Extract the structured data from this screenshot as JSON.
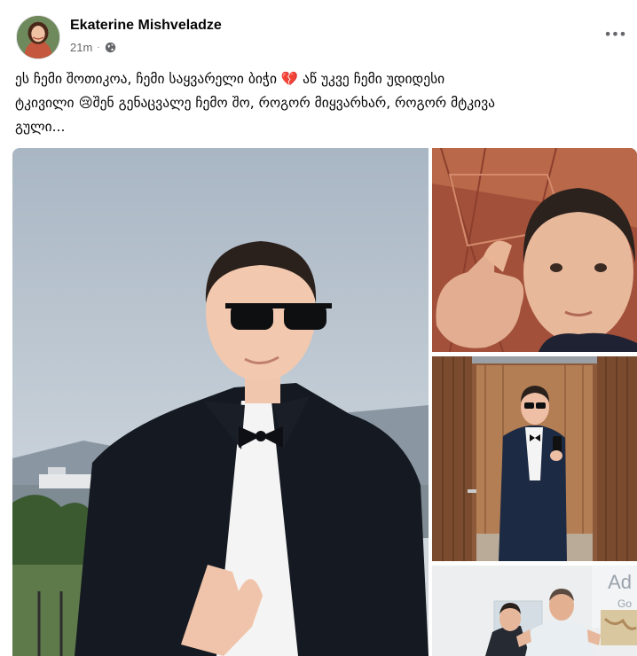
{
  "post": {
    "author": "Ekaterine Mishveladze",
    "time": "21m",
    "separator": "·",
    "visibility_icon": "globe-icon",
    "menu_icon": "more-options-icon",
    "menu_label": "•••",
    "text_lines": [
      "ეს ჩემი შოთიკოა, ჩემი საყვარელი ბიჭი 💔 აწ უკვე ჩემი უდიდესი",
      "ტკივილი 😢შენ გენაცვალე ჩემო შო, როგორ მიყვარხარ, როგორ მტკივა",
      "გული..."
    ]
  },
  "photos": {
    "count": 4,
    "fourth_sign_text": [
      "Ad",
      "Go"
    ]
  },
  "colors": {
    "text_primary": "#050505",
    "text_secondary": "#65676b",
    "background": "#ffffff"
  }
}
